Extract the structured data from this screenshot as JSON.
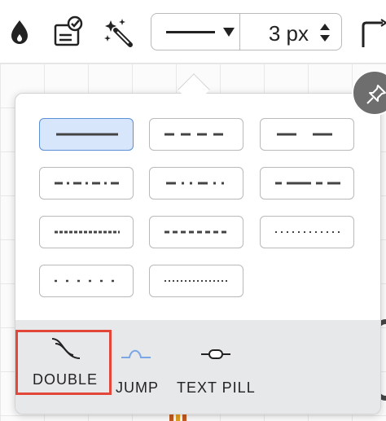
{
  "toolbar": {
    "icons": [
      "fill-drop-icon",
      "style-stamp-icon",
      "magic-wand-icon",
      "line-corner-icon"
    ],
    "line_style_preview": "solid",
    "stroke_width": "3 px"
  },
  "popup": {
    "line_styles": [
      {
        "name": "solid",
        "selected": true
      },
      {
        "name": "dashed",
        "selected": false
      },
      {
        "name": "long-dash",
        "selected": false
      },
      {
        "name": "dash-dot",
        "selected": false
      },
      {
        "name": "dash-dot-dot",
        "selected": false
      },
      {
        "name": "long-short-dash",
        "selected": false
      },
      {
        "name": "dense-dash",
        "selected": false
      },
      {
        "name": "small-dash",
        "selected": false
      },
      {
        "name": "fine-dot",
        "selected": false
      },
      {
        "name": "sparse-dot",
        "selected": false
      },
      {
        "name": "dense-dot",
        "selected": false
      }
    ],
    "line_jumps": [
      {
        "label": "DOUBLE",
        "selected": true
      },
      {
        "label": "JUMP",
        "selected": false
      },
      {
        "label": "TEXT PILL",
        "selected": false
      }
    ]
  },
  "colors": {
    "accent_selected_bg": "#d7e6fb",
    "accent_selected_border": "#5b8fd6",
    "highlight_red": "#e2473a",
    "jump_blue": "#7aa7e6"
  }
}
